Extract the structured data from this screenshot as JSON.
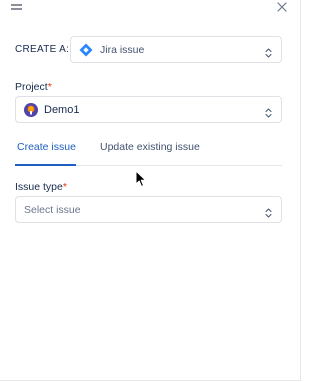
{
  "header": {
    "drag_icon": "drag-handle-icon",
    "close_icon": "close-icon"
  },
  "create": {
    "label": "CREATE A:",
    "selected": "Jira issue",
    "icon": "jira-icon"
  },
  "project": {
    "label": "Project",
    "required_mark": "*",
    "selected": "Demo1",
    "avatar": "project-avatar"
  },
  "tabs": [
    {
      "label": "Create issue",
      "active": true
    },
    {
      "label": "Update existing issue",
      "active": false
    }
  ],
  "issue_type": {
    "label": "Issue type",
    "required_mark": "*",
    "placeholder": "Select issue"
  },
  "colors": {
    "accent": "#1d5fc2",
    "jira_blue": "#2684ff",
    "required": "#de350b",
    "border": "#dfe1e6"
  }
}
